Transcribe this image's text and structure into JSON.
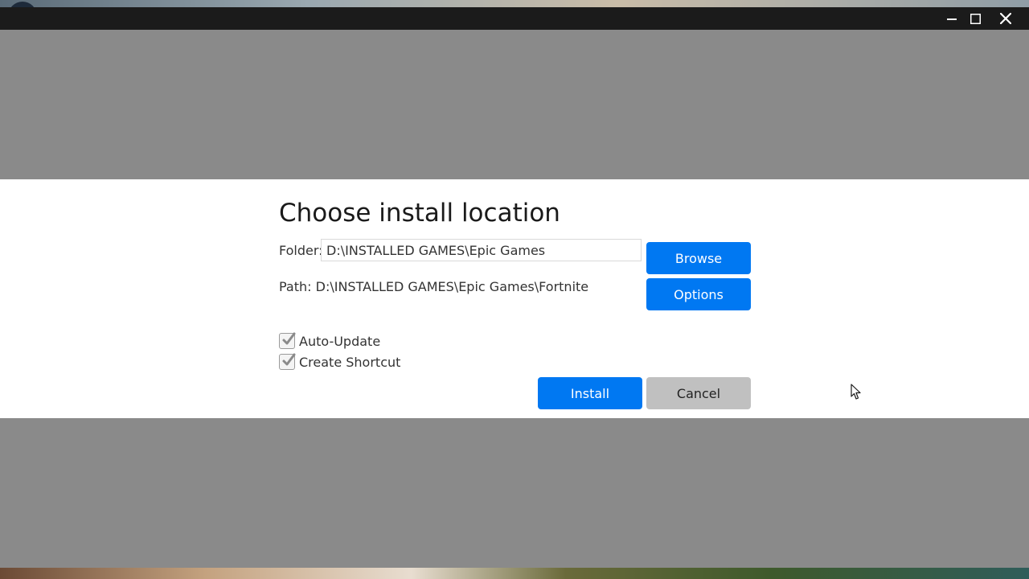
{
  "window": {
    "controls": [
      "minimize-icon",
      "maximize-icon",
      "close-icon"
    ]
  },
  "dialog": {
    "title": "Choose install location",
    "folder_label": "Folder:",
    "folder_value": "D:\\INSTALLED GAMES\\Epic Games",
    "path_text": "Path: D:\\INSTALLED GAMES\\Epic Games\\Fortnite",
    "browse_label": "Browse",
    "options_label": "Options",
    "auto_update_label": "Auto-Update",
    "auto_update_checked": true,
    "create_shortcut_label": "Create Shortcut",
    "create_shortcut_checked": true,
    "install_label": "Install",
    "cancel_label": "Cancel"
  },
  "colors": {
    "accent": "#0078f2",
    "cancel": "#c0c0c0",
    "overlay": "#8a8a8a",
    "titlebar": "#1b1b1b"
  }
}
